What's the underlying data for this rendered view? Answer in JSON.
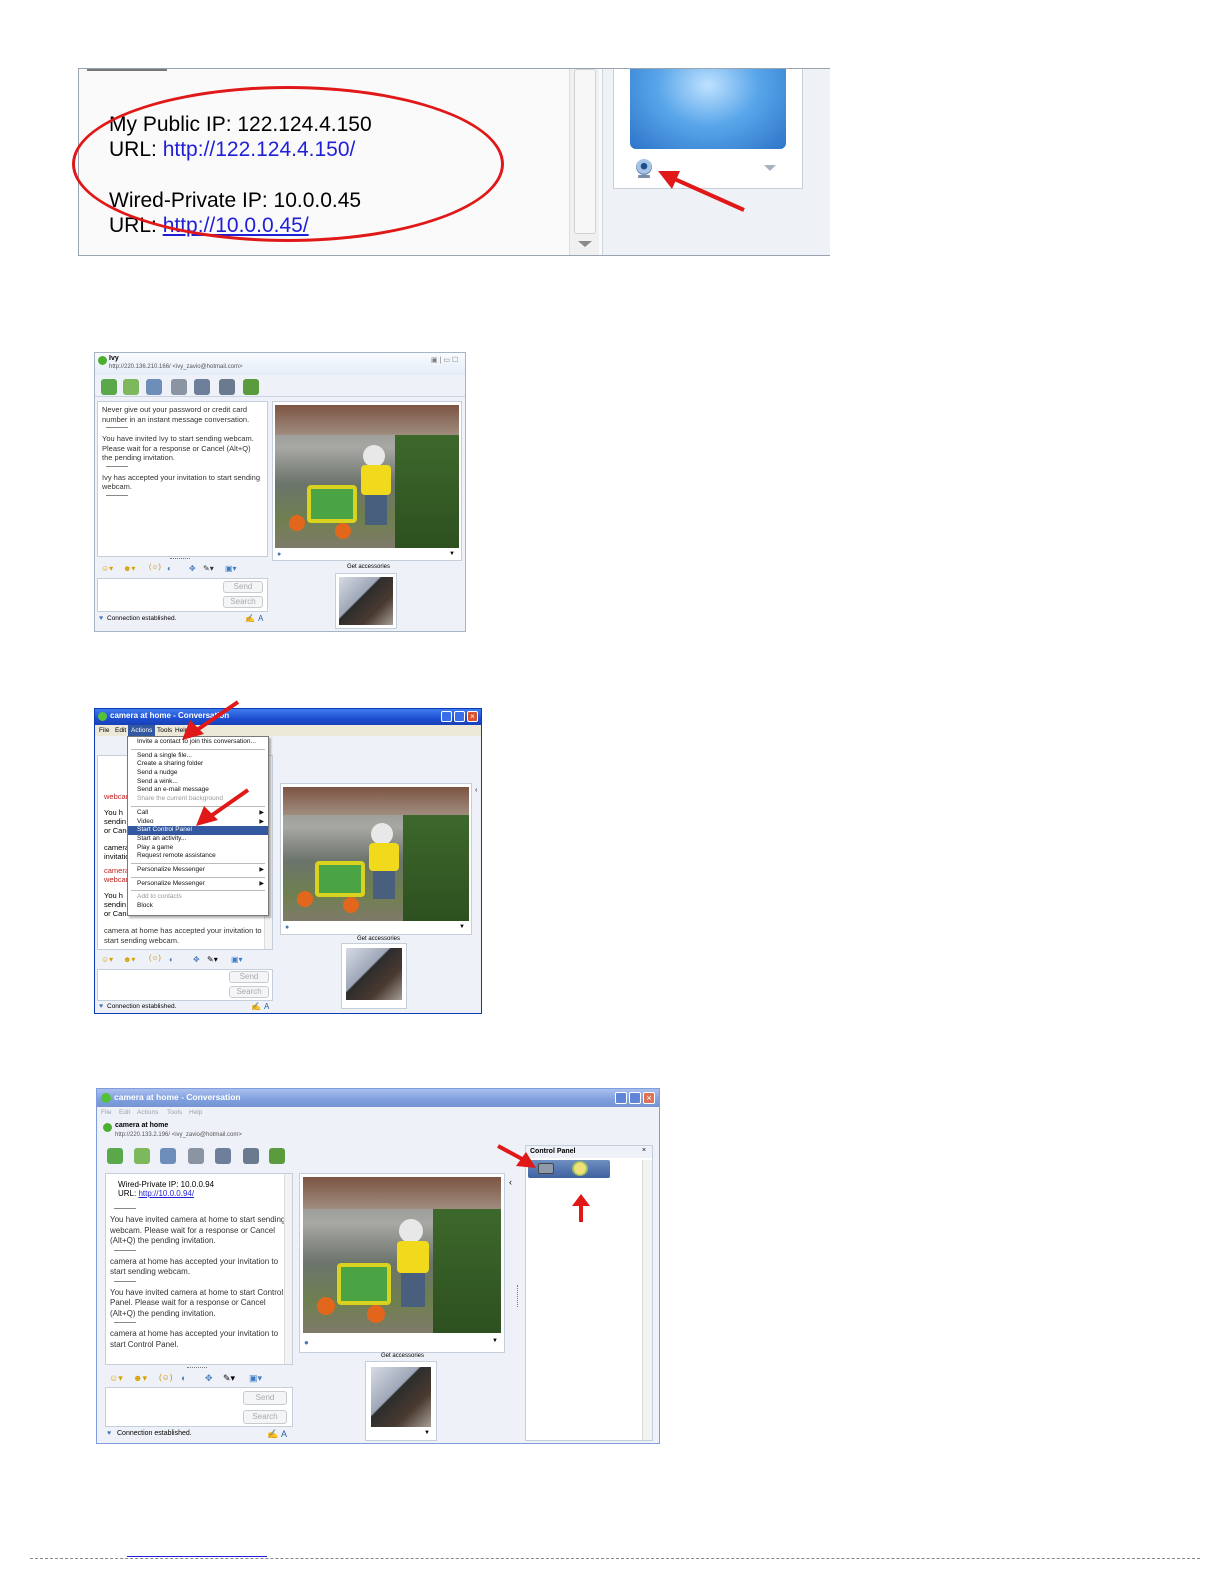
{
  "panel1": {
    "public_ip_label": "My Public IP: 122.124.4.150",
    "url_label_1": "URL:",
    "url_1": "http://122.124.4.150/",
    "private_ip_label": "Wired-Private IP: 10.0.0.45",
    "url_label_2": "URL:",
    "url_2": "http://10.0.0.45/"
  },
  "panel2": {
    "contact_name": "Ivy",
    "contact_info": "http://220.136.210.166/ <ivy_zavio@hotmail.com>",
    "messages": [
      "Never give out your password or credit card number in an instant message conversation.",
      "You have invited Ivy to start sending webcam. Please wait for a response or Cancel (Alt+Q) the pending invitation.",
      "Ivy has accepted your invitation to start sending webcam."
    ],
    "send_label": "Send",
    "search_label": "Search",
    "status": "Connection established.",
    "get_accessories": "Get accessories"
  },
  "panel3": {
    "window_title": "camera at home - Conversation",
    "menu": [
      "File",
      "Edit",
      "Actions",
      "Tools",
      "Help"
    ],
    "dropdown": [
      {
        "label": "Invite a contact to join this conversation...",
        "state": "normal"
      },
      {
        "sep": true
      },
      {
        "label": "Send a single file...",
        "state": "normal"
      },
      {
        "label": "Create a sharing folder",
        "state": "normal"
      },
      {
        "label": "Send a nudge",
        "state": "normal"
      },
      {
        "label": "Send a wink...",
        "state": "normal"
      },
      {
        "label": "Send an e-mail message",
        "state": "normal"
      },
      {
        "label": "Share the current background",
        "state": "disabled"
      },
      {
        "sep": true
      },
      {
        "label": "Call",
        "state": "normal",
        "submenu": true
      },
      {
        "label": "Video",
        "state": "normal",
        "submenu": true
      },
      {
        "label": "Start Control Panel",
        "state": "selected"
      },
      {
        "label": "Start an activity...",
        "state": "normal"
      },
      {
        "label": "Play a game",
        "state": "normal"
      },
      {
        "label": "Request remote assistance",
        "state": "normal"
      },
      {
        "sep": true
      },
      {
        "label": "Personalize Messenger",
        "state": "normal",
        "submenu": true
      },
      {
        "sep": true
      },
      {
        "label": "Personalize Messenger",
        "state": "normal",
        "submenu": true
      },
      {
        "sep": true
      },
      {
        "label": "Add to contacts",
        "state": "disabled"
      },
      {
        "label": "Block",
        "state": "normal"
      }
    ],
    "partial_messages": [
      "webcam",
      "You h",
      "sendin",
      "or Canc",
      "camera",
      "invitatio",
      "camera",
      "webcam",
      "You h",
      "sendin",
      "or Canc"
    ],
    "last_message": "camera at home has accepted your invitation to start sending webcam.",
    "send_label": "Send",
    "search_label": "Search",
    "status": "Connection established.",
    "get_accessories": "Get accessories"
  },
  "panel4": {
    "window_title": "camera at home - Conversation",
    "menu": [
      "File",
      "Edit",
      "Actions",
      "Tools",
      "Help"
    ],
    "contact_name": "camera at home",
    "contact_info": "http://220.133.2.196/ <ivy_zavio@hotmail.com>",
    "private_ip": "Wired-Private IP: 10.0.0.94",
    "url_label": "URL:",
    "url": "http://10.0.0.94/",
    "messages": [
      "You have invited camera at home to start sending webcam. Please wait for a response or Cancel (Alt+Q) the pending invitation.",
      "camera at home has accepted your invitation to start sending webcam.",
      "You have invited camera at home to start Control Panel. Please wait for a response or Cancel (Alt+Q) the pending invitation.",
      "camera at home has accepted your invitation to start Control Panel."
    ],
    "control_panel_title": "Control Panel",
    "send_label": "Send",
    "search_label": "Search",
    "status": "Connection established.",
    "get_accessories": "Get accessories"
  },
  "icons": {
    "webcam": "webcam-icon",
    "arrow": "red-arrow-annotation"
  },
  "colors": {
    "annotation_red": "#e01818",
    "link_blue": "#1f1fd6",
    "xp_title_blue": "#2456d8",
    "messenger_bg": "#eef2f8"
  }
}
